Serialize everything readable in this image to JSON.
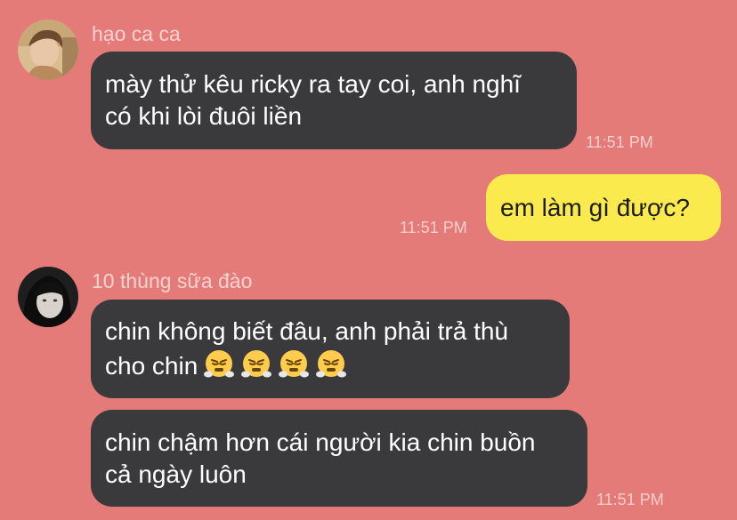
{
  "conversation": {
    "messages": [
      {
        "sender": "hạo ca ca",
        "lines": [
          "mày thử kêu ricky ra tay coi, anh nghĩ",
          "có khi lòi đuôi liền"
        ],
        "time": "11:51 PM"
      },
      {
        "sender": "",
        "lines": [
          "em làm gì được?"
        ],
        "time": "11:51 PM"
      },
      {
        "sender": "10 thùng sữa đào",
        "lines": [
          "chin không biết đâu, anh phải trả thù",
          "cho chin"
        ],
        "emoji": "face-with-steam-from-nose",
        "emoji_count": 4,
        "time": ""
      },
      {
        "sender": "",
        "lines": [
          "chin chậm hơn cái người kia chin buồn",
          "cả ngày luôn"
        ],
        "time": "11:51 PM"
      }
    ]
  },
  "colors": {
    "background": "#E57B78",
    "incoming_bubble": "#3A3A3C",
    "outgoing_bubble": "#FBEA4E",
    "sender_name": "#F6D3D1",
    "timestamp": "#F4CFCD"
  }
}
